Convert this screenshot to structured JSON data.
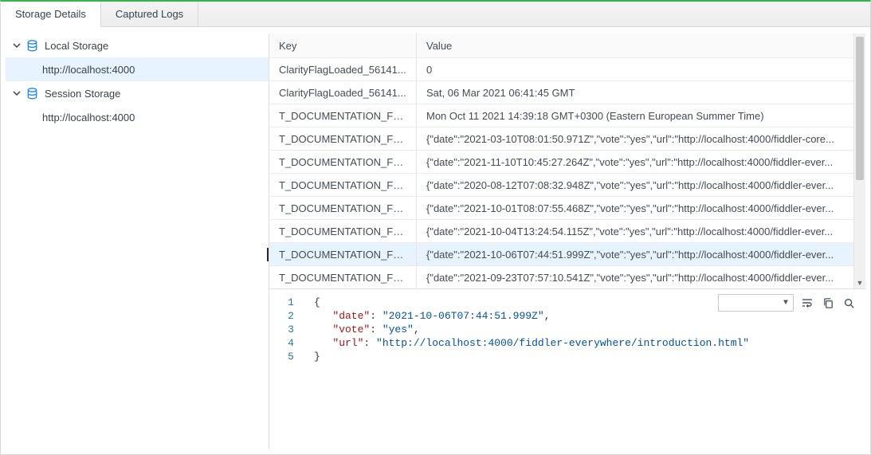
{
  "tabs": {
    "storage_details": "Storage Details",
    "captured_logs": "Captured Logs"
  },
  "sidebar": {
    "local_storage": {
      "label": "Local Storage",
      "items": [
        {
          "label": "http://localhost:4000"
        }
      ]
    },
    "session_storage": {
      "label": "Session Storage",
      "items": [
        {
          "label": "http://localhost:4000"
        }
      ]
    }
  },
  "kv": {
    "headers": {
      "key": "Key",
      "value": "Value"
    },
    "rows": [
      {
        "key": "ClarityFlagLoaded_56141...",
        "value": "0"
      },
      {
        "key": "ClarityFlagLoaded_56141...",
        "value": "Sat, 06 Mar 2021 06:41:45 GMT"
      },
      {
        "key": "T_DOCUMENTATION_FE...",
        "value": "Mon Oct 11 2021 14:39:18 GMT+0300 (Eastern European Summer Time)"
      },
      {
        "key": "T_DOCUMENTATION_FE...",
        "value": "{\"date\":\"2021-03-10T08:01:50.971Z\",\"vote\":\"yes\",\"url\":\"http://localhost:4000/fiddler-core..."
      },
      {
        "key": "T_DOCUMENTATION_FE...",
        "value": "{\"date\":\"2021-11-10T10:45:27.264Z\",\"vote\":\"yes\",\"url\":\"http://localhost:4000/fiddler-ever..."
      },
      {
        "key": "T_DOCUMENTATION_FE...",
        "value": "{\"date\":\"2020-08-12T07:08:32.948Z\",\"vote\":\"yes\",\"url\":\"http://localhost:4000/fiddler-ever..."
      },
      {
        "key": "T_DOCUMENTATION_FE...",
        "value": "{\"date\":\"2021-10-01T08:07:55.468Z\",\"vote\":\"yes\",\"url\":\"http://localhost:4000/fiddler-ever..."
      },
      {
        "key": "T_DOCUMENTATION_FE...",
        "value": "{\"date\":\"2021-10-04T13:24:54.115Z\",\"vote\":\"yes\",\"url\":\"http://localhost:4000/fiddler-ever..."
      },
      {
        "key": "T_DOCUMENTATION_FE...",
        "value": "{\"date\":\"2021-10-06T07:44:51.999Z\",\"vote\":\"yes\",\"url\":\"http://localhost:4000/fiddler-ever..."
      },
      {
        "key": "T_DOCUMENTATION_FE...",
        "value": "{\"date\":\"2021-09-23T07:57:10.541Z\",\"vote\":\"yes\",\"url\":\"http://localhost:4000/fiddler-ever..."
      }
    ],
    "selected_index": 8
  },
  "json_preview": {
    "lines": [
      "1",
      "2",
      "3",
      "4",
      "5"
    ],
    "date_key": "\"date\"",
    "date_val": "\"2021-10-06T07:44:51.999Z\"",
    "vote_key": "\"vote\"",
    "vote_val": "\"yes\"",
    "url_key": "\"url\"",
    "url_val": "\"http://localhost:4000/fiddler-everywhere/introduction.html\""
  }
}
